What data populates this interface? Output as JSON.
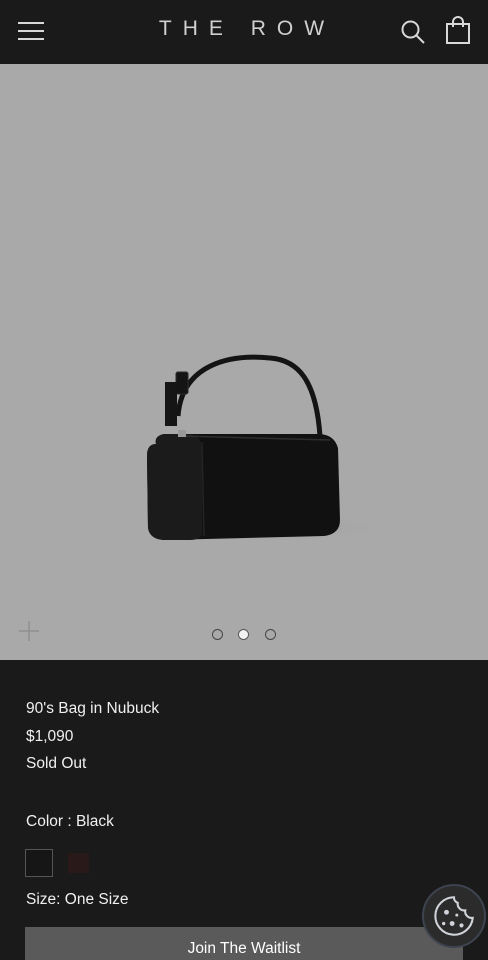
{
  "header": {
    "logo": "THE ROW",
    "menu_icon": "hamburger-menu-icon",
    "search_icon": "search-icon",
    "cart_icon": "shopping-bag-icon"
  },
  "gallery": {
    "zoom_icon": "plus-icon",
    "slide_count": 3,
    "active_slide": 2
  },
  "product": {
    "name": "90's Bag in Nubuck",
    "price": "$1,090",
    "availability": "Sold Out",
    "color_label": "Color : Black",
    "swatches": [
      {
        "name": "Black",
        "color": "#161616",
        "selected": true
      },
      {
        "name": "Brown",
        "color": "#2a1919",
        "selected": false
      }
    ],
    "size_label": "Size: One Size",
    "cta": "Join The Waitlist"
  },
  "cookie": {
    "icon": "cookie-icon"
  },
  "colors": {
    "header_bg": "#1a1a1a",
    "image_bg": "#a9a9a9",
    "button_bg": "#5a5a5a"
  }
}
